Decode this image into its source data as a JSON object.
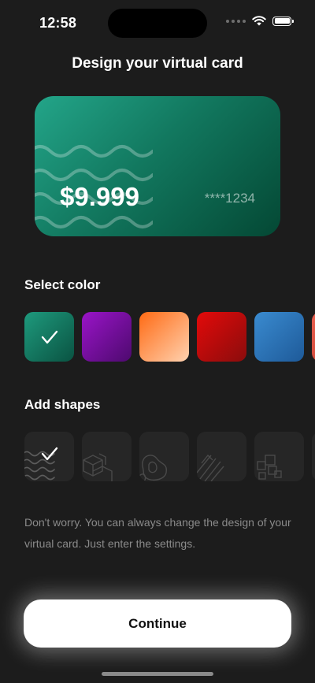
{
  "status_bar": {
    "time": "12:58",
    "icons": [
      "cellular-dots-icon",
      "wifi-icon",
      "battery-icon"
    ]
  },
  "page_title": "Design your virtual card",
  "card": {
    "amount": "$9.999",
    "masked_number": "****1234",
    "pattern": "waves",
    "gradient": [
      "#23a589",
      "#044834"
    ]
  },
  "color_section": {
    "label": "Select color",
    "selected_index": 0,
    "options": [
      {
        "name": "green",
        "from": "#1e9a7d",
        "to": "#0a5342"
      },
      {
        "name": "purple",
        "from": "#9a14c8",
        "to": "#4d0a6e"
      },
      {
        "name": "orange",
        "from": "#ff6a14",
        "to": "#ffd2b0"
      },
      {
        "name": "red",
        "from": "#e30a0a",
        "to": "#8a0c0c"
      },
      {
        "name": "blue",
        "from": "#3a8bd0",
        "to": "#1e5a99"
      },
      {
        "name": "coral",
        "from": "#e86050",
        "to": "#c23a2c"
      }
    ]
  },
  "shapes_section": {
    "label": "Add shapes",
    "selected_index": 0,
    "options": [
      "waves",
      "cubes",
      "blobs",
      "stripes",
      "squares",
      "more"
    ]
  },
  "hint": "Don't worry. You can always change the design of your virtual card. Just enter the settings.",
  "continue_label": "Continue"
}
